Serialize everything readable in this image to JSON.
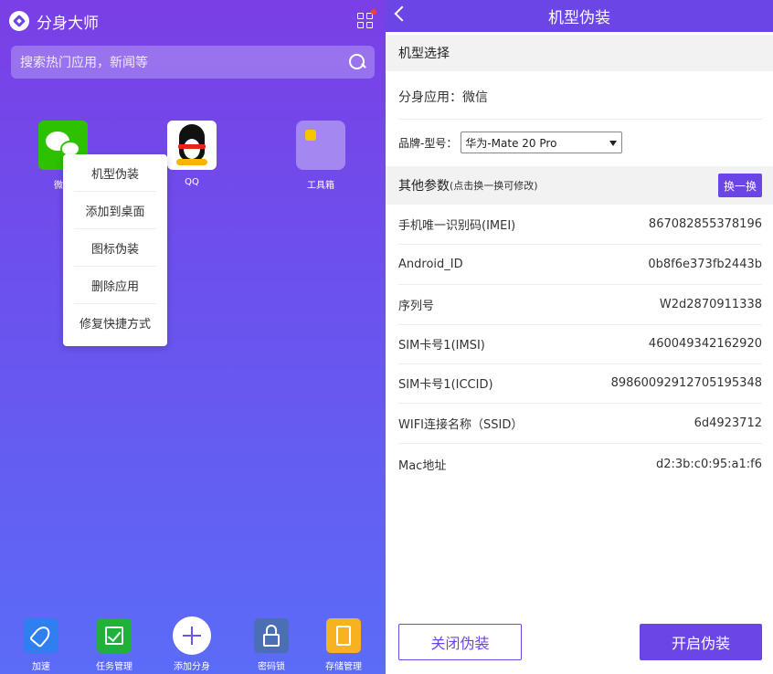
{
  "left": {
    "app_title": "分身大师",
    "search_placeholder": "搜索热门应用，新闻等",
    "apps": [
      {
        "label": "微信",
        "icon": "wechat-icon"
      },
      {
        "label": "QQ",
        "icon": "qq-icon"
      },
      {
        "label": "工具箱",
        "icon": "toolbox-icon"
      }
    ],
    "context_menu": [
      "机型伪装",
      "添加到桌面",
      "图标伪装",
      "删除应用",
      "修复快捷方式"
    ],
    "dock": [
      {
        "label": "加速",
        "icon": "rocket-icon"
      },
      {
        "label": "任务管理",
        "icon": "checkbox-icon"
      },
      {
        "label": "添加分身",
        "icon": "plus-icon"
      },
      {
        "label": "密码锁",
        "icon": "padlock-icon"
      },
      {
        "label": "存储管理",
        "icon": "sd-card-icon"
      }
    ]
  },
  "right": {
    "title": "机型伪装",
    "section_model": "机型选择",
    "clone_app": "分身应用：微信",
    "brand_label": "品牌-型号：",
    "brand_value": "华为-Mate 20 Pro",
    "section_other": "其他参数",
    "section_other_note": "(点击换一换可修改)",
    "swap_button": "换一换",
    "params": [
      {
        "label": "手机唯一识别码(IMEI)",
        "value": "867082855378196"
      },
      {
        "label": "Android_ID",
        "value": "0b8f6e373fb2443b"
      },
      {
        "label": "序列号",
        "value": "W2d2870911338"
      },
      {
        "label": "SIM卡号1(IMSI)",
        "value": "460049342162920"
      },
      {
        "label": "SIM卡号1(ICCID)",
        "value": "89860092912705195348"
      },
      {
        "label": "WIFI连接名称（SSID）",
        "value": "6d4923712"
      },
      {
        "label": "Mac地址",
        "value": "d2:3b:c0:95:a1:f6"
      }
    ],
    "close_button": "关闭伪装",
    "open_button": "开启伪装"
  },
  "colors": {
    "accent": "#6b45e6",
    "wechat": "#2dc100"
  }
}
